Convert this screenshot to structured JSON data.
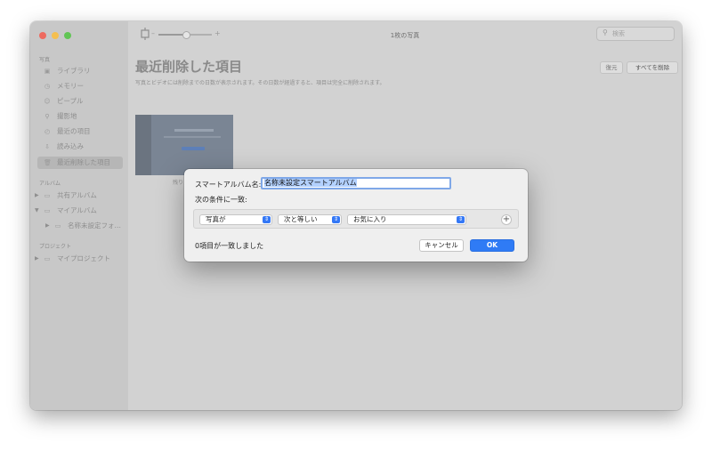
{
  "window": {
    "title": "1枚の写真"
  },
  "search": {
    "placeholder": "検索"
  },
  "sidebar": {
    "sections": [
      {
        "title": "写真"
      },
      {
        "title": "アルバム"
      },
      {
        "title": "プロジェクト"
      }
    ],
    "library_items": [
      {
        "label": "ライブラリ",
        "icon": "photo-library-icon"
      },
      {
        "label": "メモリー",
        "icon": "memories-icon"
      },
      {
        "label": "ピープル",
        "icon": "people-icon"
      },
      {
        "label": "撮影地",
        "icon": "places-icon"
      },
      {
        "label": "最近の項目",
        "icon": "recents-icon"
      },
      {
        "label": "読み込み",
        "icon": "import-icon"
      },
      {
        "label": "最近削除した項目",
        "icon": "trash-icon",
        "selected": true
      }
    ],
    "album_items": [
      {
        "label": "共有アルバム",
        "icon": "folder-icon"
      },
      {
        "label": "マイアルバム",
        "icon": "folder-icon"
      },
      {
        "label": "名称未設定フォ…",
        "icon": "folder-icon"
      }
    ],
    "project_items": [
      {
        "label": "マイプロジェクト",
        "icon": "folder-icon"
      }
    ]
  },
  "main": {
    "title": "最近削除した項目",
    "subtitle": "写真とビデオには削除までの日数が表示されます。その日数が経過すると、項目は完全に削除されます。",
    "recover_label": "復元",
    "delete_all_label": "すべてを削除",
    "thumb_caption": "残り"
  },
  "dialog": {
    "name_label": "スマートアルバム名:",
    "name_value": "名称未設定スマートアルバム",
    "condition_label": "次の条件に一致:",
    "rule": {
      "field": "写真が",
      "operator": "次と等しい",
      "value": "お気に入り"
    },
    "match_count": "0項目が一致しました",
    "cancel_label": "キャンセル",
    "ok_label": "OK"
  },
  "colors": {
    "accent": "#2f7bf5",
    "selection": "#b3d1ff"
  }
}
